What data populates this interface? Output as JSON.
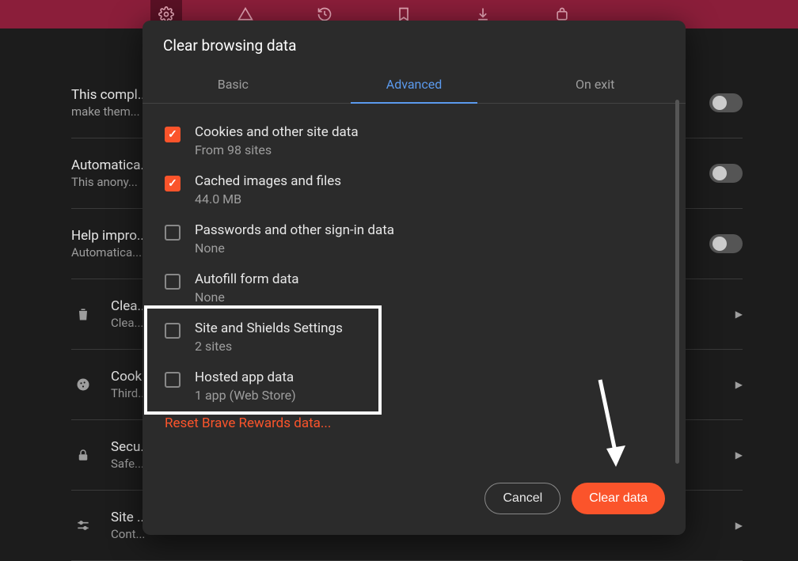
{
  "toolbar": {
    "icons": [
      "settings-gear",
      "warning-triangle",
      "history",
      "bookmark",
      "download",
      "extensions"
    ]
  },
  "background": {
    "rows": [
      {
        "title": "This compl...",
        "sub": "make them...",
        "has_toggle": true
      },
      {
        "title": "Automatica...",
        "sub": "This anony...",
        "has_toggle": true
      },
      {
        "title": "Help impro...",
        "sub": "Automatica...",
        "has_toggle": true
      },
      {
        "icon": "trash",
        "title": "Clea...",
        "sub": "Clea...",
        "has_chevron": true
      },
      {
        "icon": "cookie",
        "title": "Cook...",
        "sub": "Third...",
        "has_chevron": true
      },
      {
        "icon": "lock",
        "title": "Secu...",
        "sub": "Safe...",
        "has_chevron": true
      },
      {
        "icon": "sliders",
        "title": "Site ...",
        "sub": "Cont...",
        "has_chevron": true
      }
    ]
  },
  "modal": {
    "title": "Clear browsing data",
    "tabs": [
      {
        "label": "Basic",
        "active": false
      },
      {
        "label": "Advanced",
        "active": true
      },
      {
        "label": "On exit",
        "active": false
      }
    ],
    "options": [
      {
        "checked": true,
        "title": "Cookies and other site data",
        "sub": "From 98 sites"
      },
      {
        "checked": true,
        "title": "Cached images and files",
        "sub": "44.0 MB"
      },
      {
        "checked": false,
        "title": "Passwords and other sign-in data",
        "sub": "None"
      },
      {
        "checked": false,
        "title": "Autofill form data",
        "sub": "None"
      },
      {
        "checked": false,
        "title": "Site and Shields Settings",
        "sub": "2 sites"
      },
      {
        "checked": false,
        "title": "Hosted app data",
        "sub": "1 app (Web Store)"
      }
    ],
    "reset_link": "Reset Brave Rewards data...",
    "cancel_label": "Cancel",
    "confirm_label": "Clear data"
  },
  "colors": {
    "accent_orange": "#fb542b",
    "accent_blue": "#5b9aed"
  }
}
